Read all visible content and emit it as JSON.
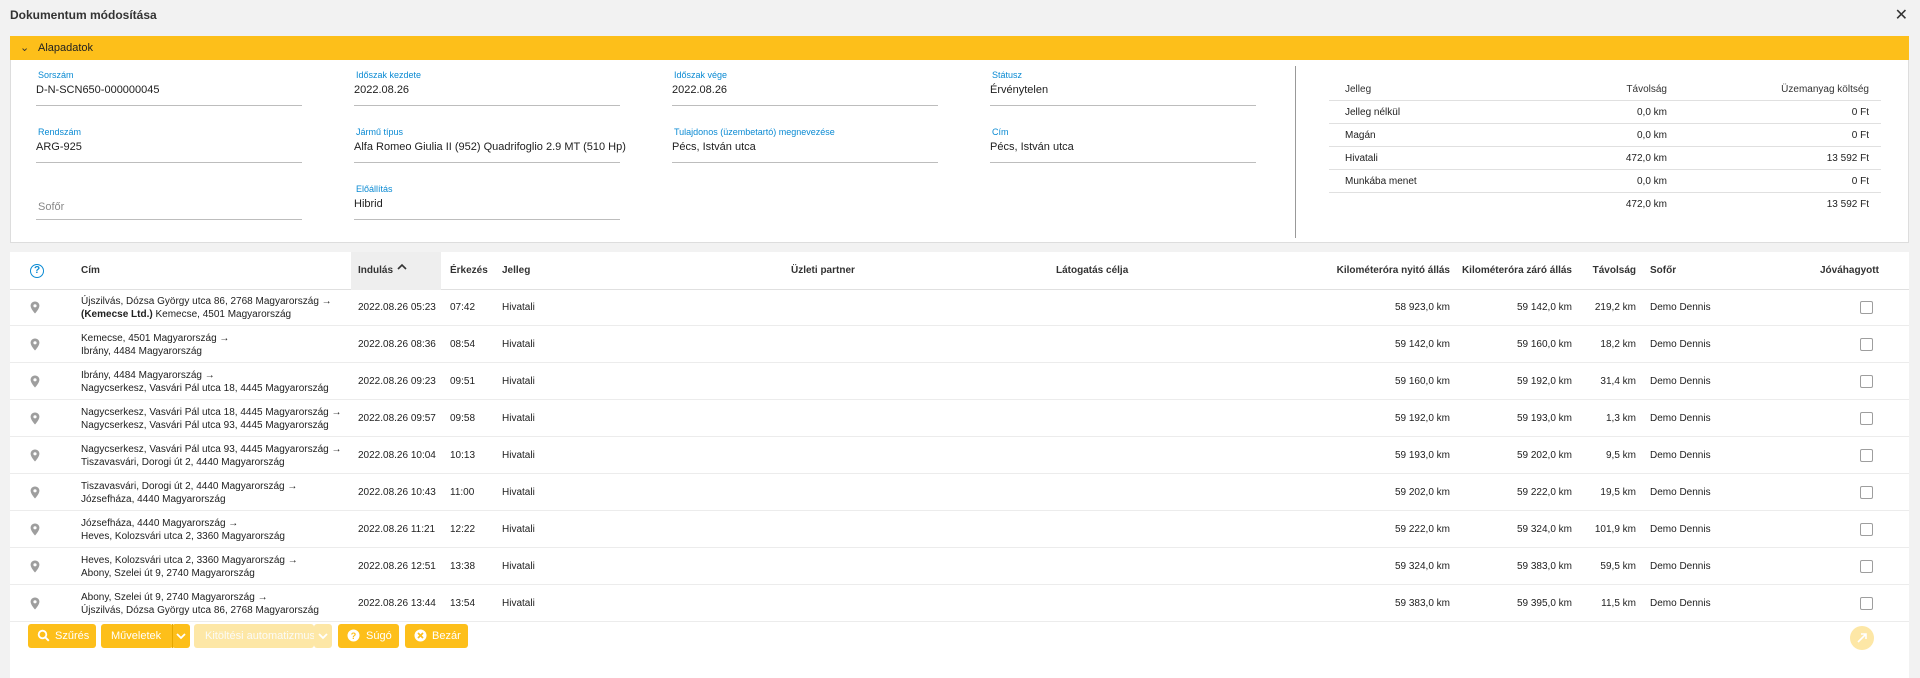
{
  "window": {
    "title": "Dokumentum módosítása"
  },
  "section": {
    "title": "Alapadatok"
  },
  "fields": {
    "sorszam": {
      "label": "Sorszám",
      "value": "D-N-SCN650-000000045"
    },
    "idoszak_kezdete": {
      "label": "Időszak kezdete",
      "value": "2022.08.26"
    },
    "idoszak_vege": {
      "label": "Időszak vége",
      "value": "2022.08.26"
    },
    "statusz": {
      "label": "Státusz",
      "value": "Érvénytelen"
    },
    "rendszam": {
      "label": "Rendszám",
      "value": "ARG-925"
    },
    "jarmu_tipus": {
      "label": "Jármű típus",
      "value": "Alfa Romeo Giulia II (952) Quadrifoglio 2.9 MT (510 Hp)"
    },
    "tulajdonos": {
      "label": "Tulajdonos (üzembetartó) megnevezése",
      "value": "Pécs, István utca"
    },
    "cim": {
      "label": "Cím",
      "value": "Pécs, István utca"
    },
    "sofor": {
      "placeholder": "Sofőr"
    },
    "elohajtas": {
      "label": "Előállítás",
      "value": "Hibrid"
    }
  },
  "summary": {
    "headers": [
      "Jelleg",
      "Távolság",
      "Üzemanyag költség"
    ],
    "rows": [
      [
        "Jelleg nélkül",
        "0,0 km",
        "0 Ft"
      ],
      [
        "Magán",
        "0,0 km",
        "0 Ft"
      ],
      [
        "Hivatali",
        "472,0 km",
        "13 592 Ft"
      ],
      [
        "Munkába menet",
        "0,0 km",
        "0 Ft"
      ]
    ],
    "total": [
      "",
      "472,0 km",
      "13 592 Ft"
    ]
  },
  "grid": {
    "help_icon": "question-circle-icon",
    "columns": {
      "cim": "Cím",
      "indulas": "Indulás",
      "erkezes": "Érkezés",
      "jelleg": "Jelleg",
      "uzleti_partner": "Üzleti partner",
      "latogatas_celja": "Látogatás célja",
      "km_nyito": "Kilométeróra nyitó állás",
      "km_zaro": "Kilométeróra záró állás",
      "tavolsag": "Távolság",
      "sofor": "Sofőr",
      "jovahagyott": "Jóváhagyott"
    },
    "sort_icon": "sort-ascending-icon",
    "rows": [
      {
        "line1": "Újszilvás, Dózsa György utca 86, 2768 Magyarország →",
        "line2_bold": "(Kemecse Ltd.)",
        "line2": " Kemecse, 4501 Magyarország",
        "indulas": "2022.08.26 05:23",
        "erkezes": "07:42",
        "jelleg": "Hivatali",
        "km_nyito": "58 923,0 km",
        "km_zaro": "59 142,0 km",
        "tavolsag": "219,2 km",
        "sofor": "Demo Dennis",
        "approved": false
      },
      {
        "line1": "Kemecse, 4501 Magyarország →",
        "line2_bold": "",
        "line2": "Ibrány, 4484 Magyarország",
        "indulas": "2022.08.26 08:36",
        "erkezes": "08:54",
        "jelleg": "Hivatali",
        "km_nyito": "59 142,0 km",
        "km_zaro": "59 160,0 km",
        "tavolsag": "18,2 km",
        "sofor": "Demo Dennis",
        "approved": false
      },
      {
        "line1": "Ibrány, 4484 Magyarország →",
        "line2_bold": "",
        "line2": "Nagycserkesz, Vasvári Pál utca 18, 4445 Magyarország",
        "indulas": "2022.08.26 09:23",
        "erkezes": "09:51",
        "jelleg": "Hivatali",
        "km_nyito": "59 160,0 km",
        "km_zaro": "59 192,0 km",
        "tavolsag": "31,4 km",
        "sofor": "Demo Dennis",
        "approved": false
      },
      {
        "line1": "Nagycserkesz, Vasvári Pál utca 18, 4445 Magyarország →",
        "line2_bold": "",
        "line2": "Nagycserkesz, Vasvári Pál utca 93, 4445 Magyarország",
        "indulas": "2022.08.26 09:57",
        "erkezes": "09:58",
        "jelleg": "Hivatali",
        "km_nyito": "59 192,0 km",
        "km_zaro": "59 193,0 km",
        "tavolsag": "1,3 km",
        "sofor": "Demo Dennis",
        "approved": false
      },
      {
        "line1": "Nagycserkesz, Vasvári Pál utca 93, 4445 Magyarország →",
        "line2_bold": "",
        "line2": "Tiszavasvári, Dorogi út 2, 4440 Magyarország",
        "indulas": "2022.08.26 10:04",
        "erkezes": "10:13",
        "jelleg": "Hivatali",
        "km_nyito": "59 193,0 km",
        "km_zaro": "59 202,0 km",
        "tavolsag": "9,5 km",
        "sofor": "Demo Dennis",
        "approved": false
      },
      {
        "line1": "Tiszavasvári, Dorogi út 2, 4440 Magyarország →",
        "line2_bold": "",
        "line2": "Józsefháza, 4440 Magyarország",
        "indulas": "2022.08.26 10:43",
        "erkezes": "11:00",
        "jelleg": "Hivatali",
        "km_nyito": "59 202,0 km",
        "km_zaro": "59 222,0 km",
        "tavolsag": "19,5 km",
        "sofor": "Demo Dennis",
        "approved": false
      },
      {
        "line1": "Józsefháza, 4440 Magyarország →",
        "line2_bold": "",
        "line2": "Heves, Kolozsvári utca 2, 3360 Magyarország",
        "indulas": "2022.08.26 11:21",
        "erkezes": "12:22",
        "jelleg": "Hivatali",
        "km_nyito": "59 222,0 km",
        "km_zaro": "59 324,0 km",
        "tavolsag": "101,9 km",
        "sofor": "Demo Dennis",
        "approved": false
      },
      {
        "line1": "Heves, Kolozsvári utca 2, 3360 Magyarország →",
        "line2_bold": "",
        "line2": "Abony, Szelei út 9, 2740 Magyarország",
        "indulas": "2022.08.26 12:51",
        "erkezes": "13:38",
        "jelleg": "Hivatali",
        "km_nyito": "59 324,0 km",
        "km_zaro": "59 383,0 km",
        "tavolsag": "59,5 km",
        "sofor": "Demo Dennis",
        "approved": false
      },
      {
        "line1": "Abony, Szelei út 9, 2740 Magyarország →",
        "line2_bold": "",
        "line2": "Újszilvás, Dózsa György utca 86, 2768 Magyarország",
        "indulas": "2022.08.26 13:44",
        "erkezes": "13:54",
        "jelleg": "Hivatali",
        "km_nyito": "59 383,0 km",
        "km_zaro": "59 395,0 km",
        "tavolsag": "11,5 km",
        "sofor": "Demo Dennis",
        "approved": false
      }
    ]
  },
  "toolbar": {
    "szures": "Szűrés",
    "muveletek": "Műveletek",
    "kitoltesi": "Kitöltési automatizmusok",
    "sugo": "Súgó",
    "bezar": "Bezár"
  },
  "colors": {
    "accent": "#fdbf1a",
    "label_blue": "#0a8ad3"
  }
}
